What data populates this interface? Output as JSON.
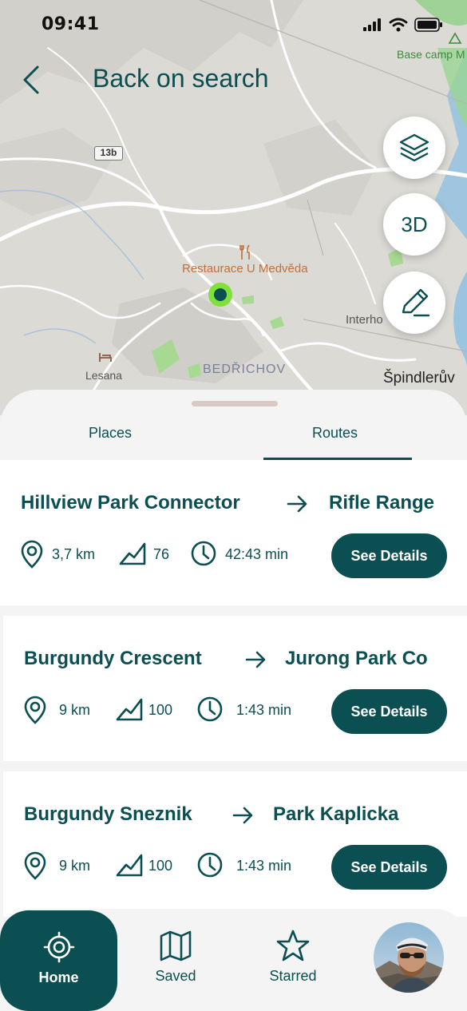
{
  "status_bar": {
    "time": "09:41"
  },
  "header": {
    "title": "Back on search"
  },
  "map": {
    "labels": {
      "restaurant": "Restaurace U Medvěda",
      "basecamp": "Base camp M",
      "interhotel": "Interho",
      "bedrichov": "BEDŘICHOV",
      "lesana": "Lesana",
      "spindleruv": "Špindlerův",
      "road_number": "13b"
    },
    "buttons": {
      "three_d": "3D"
    }
  },
  "tabs": [
    {
      "label": "Places",
      "active": false
    },
    {
      "label": "Routes",
      "active": true
    }
  ],
  "routes": [
    {
      "from": "Hillview Park Connector",
      "to": "Rifle Range",
      "distance": "3,7 km",
      "elevation": "76",
      "duration": "42:43 min",
      "button": "See Details"
    },
    {
      "from": "Burgundy Crescent",
      "to": "Jurong Park Co",
      "distance": "9 km",
      "elevation": "100",
      "duration": "1:43 min",
      "button": "See Details"
    },
    {
      "from": "Burgundy Sneznik",
      "to": "Park Kaplicka",
      "distance": "9 km",
      "elevation": "100",
      "duration": "1:43 min",
      "button": "See Details"
    }
  ],
  "bottom_nav": [
    {
      "label": "Home",
      "icon": "target-icon",
      "active": true
    },
    {
      "label": "Saved",
      "icon": "map-icon",
      "active": false
    },
    {
      "label": "Starred",
      "icon": "star-icon",
      "active": false
    }
  ],
  "colors": {
    "primary": "#0b4f52",
    "accent_green": "#7fe13a",
    "map_bg": "#dcdad5",
    "restaurant_label": "#c0703a"
  }
}
